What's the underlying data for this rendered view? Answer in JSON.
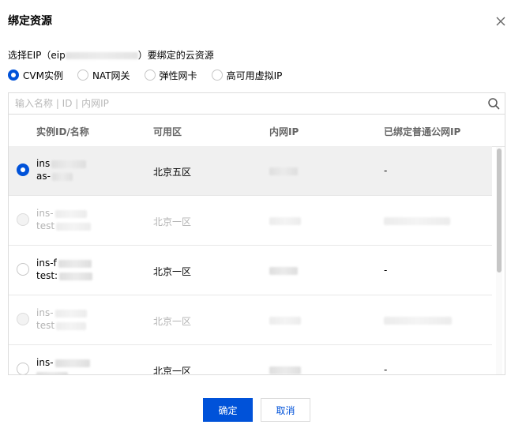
{
  "dialog": {
    "title": "绑定资源",
    "description_prefix": "选择EIP（eip",
    "description_suffix": "）要绑定的云资源",
    "close_icon": "close-icon"
  },
  "resource_types": [
    {
      "label": "CVM实例",
      "selected": true
    },
    {
      "label": "NAT网关",
      "selected": false
    },
    {
      "label": "弹性网卡",
      "selected": false
    },
    {
      "label": "高可用虚拟IP",
      "selected": false
    }
  ],
  "search": {
    "placeholder": "输入名称 | ID | 内网IP",
    "value": "",
    "icon": "search-icon"
  },
  "table": {
    "columns": [
      "实例ID/名称",
      "可用区",
      "内网IP",
      "已绑定普通公网IP"
    ],
    "rows": [
      {
        "id": "ins",
        "name": "as-",
        "zone": "北京五区",
        "public_ip": "-",
        "selected": true,
        "disabled": false
      },
      {
        "id": "ins-",
        "name": "test",
        "zone": "北京一区",
        "public_ip": "",
        "selected": false,
        "disabled": true
      },
      {
        "id": "ins-f",
        "name": "test:",
        "zone": "北京一区",
        "public_ip": "-",
        "selected": false,
        "disabled": false
      },
      {
        "id": "ins-",
        "name": "test",
        "zone": "北京一区",
        "public_ip": "",
        "selected": false,
        "disabled": true
      },
      {
        "id": "ins-",
        "name": "",
        "zone": "北京一区",
        "public_ip": "-",
        "selected": false,
        "disabled": false
      }
    ]
  },
  "footer": {
    "confirm_label": "确定",
    "cancel_label": "取消"
  },
  "colors": {
    "primary": "#0052d9",
    "selected_row": "#f0f0f0",
    "disabled_text": "#b3b3b3"
  }
}
